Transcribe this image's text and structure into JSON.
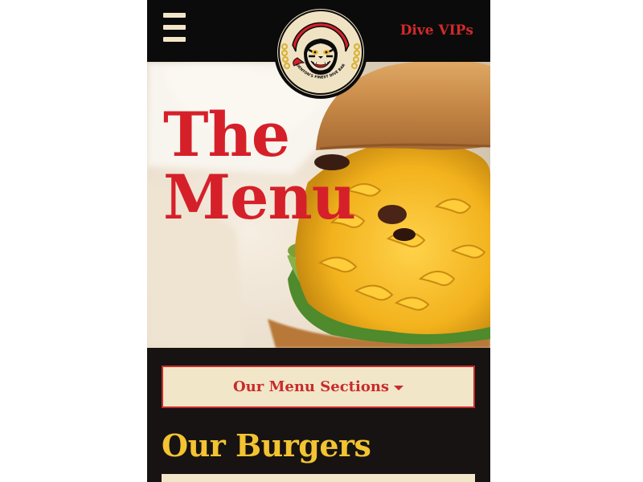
{
  "header": {
    "menu_icon": "hamburger-icon",
    "logo": {
      "icon": "cool-beans-logo",
      "text_top": "COOL BEANS",
      "text_bottom": "DENTON'S FINEST DIVE BAR"
    },
    "vip_link": "Dive VIPs"
  },
  "hero": {
    "title_line1": "The",
    "title_line2": "Menu",
    "image": "burger-with-mac-and-cheese-photo"
  },
  "sections_dropdown": {
    "label": "Our Menu Sections",
    "icon": "caret-down-icon"
  },
  "section": {
    "heading": "Our Burgers"
  },
  "colors": {
    "header_bg": "#0c0b0b",
    "page_bg": "#161312",
    "accent_red": "#d5202a",
    "cream": "#f2e6c9",
    "heading_yellow": "#f3c332"
  }
}
